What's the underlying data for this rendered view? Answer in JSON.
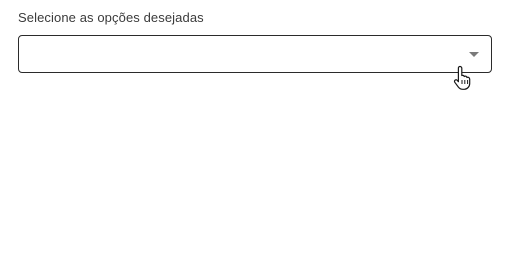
{
  "form": {
    "select_label": "Selecione as opções desejadas",
    "select_value": ""
  },
  "icons": {
    "dropdown": "chevron-down-icon",
    "pointer": "hand-pointer-cursor-icon"
  },
  "colors": {
    "border": "#2b2b2b",
    "label": "#3b3b3b",
    "chevron": "#7a7a7a"
  }
}
